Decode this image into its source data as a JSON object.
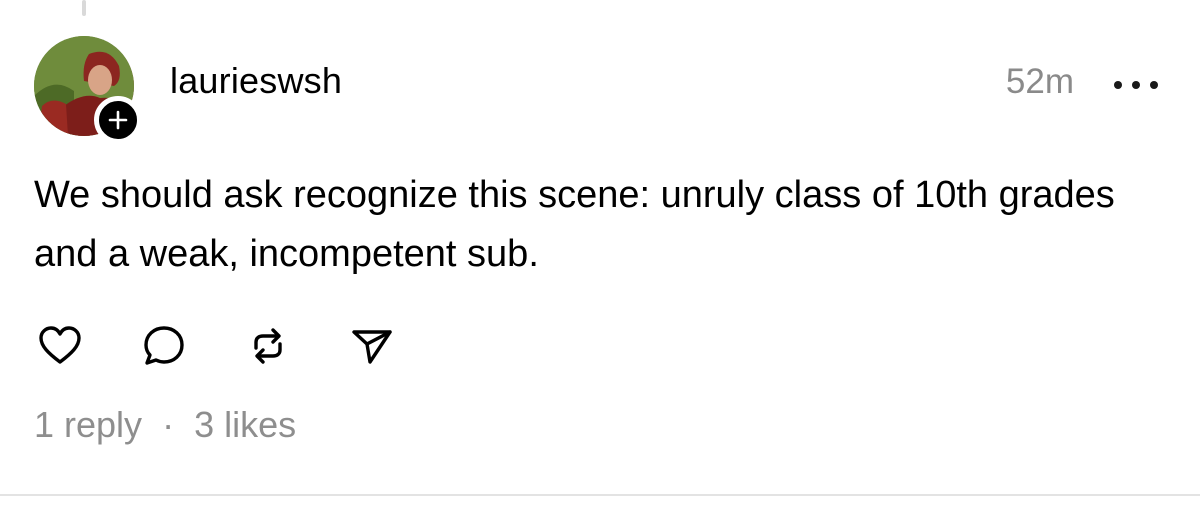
{
  "post": {
    "username": "laurieswsh",
    "timestamp": "52m",
    "text": "We should ask recognize this scene: unruly class of 10th grades and a weak, incompetent sub.",
    "replies": "1 reply",
    "separator": "·",
    "likes": "3 likes"
  },
  "icons": {
    "follow": "plus-icon",
    "more": "more-icon",
    "like": "heart-icon",
    "reply": "comment-icon",
    "repost": "repost-icon",
    "share": "send-icon"
  },
  "colors": {
    "text": "#000000",
    "muted": "#8e8e8e",
    "divider": "#e3e3e3"
  }
}
